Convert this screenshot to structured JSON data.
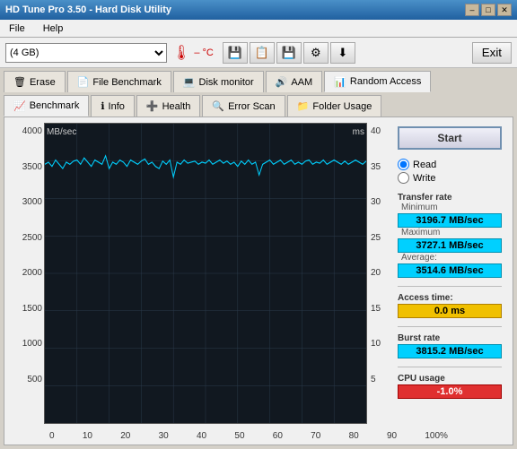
{
  "titleBar": {
    "title": "HD Tune Pro 3.50 - Hard Disk Utility",
    "minButton": "–",
    "maxButton": "□",
    "closeButton": "✕"
  },
  "menu": {
    "items": [
      "File",
      "Help"
    ]
  },
  "toolbar": {
    "driveLabel": "(4 GB)",
    "temp": "– °C",
    "exitLabel": "Exit"
  },
  "tabs1": [
    {
      "label": "Erase",
      "icon": "🗑"
    },
    {
      "label": "File Benchmark",
      "icon": "📄"
    },
    {
      "label": "Disk monitor",
      "icon": "💻"
    },
    {
      "label": "AAM",
      "icon": "🔊"
    },
    {
      "label": "Random Access",
      "icon": "📊",
      "active": true
    }
  ],
  "tabs2": [
    {
      "label": "Benchmark",
      "icon": "📈",
      "active": true
    },
    {
      "label": "Info",
      "icon": "ℹ"
    },
    {
      "label": "Health",
      "icon": "➕"
    },
    {
      "label": "Error Scan",
      "icon": "🔍"
    },
    {
      "label": "Folder Usage",
      "icon": "📁"
    }
  ],
  "chart": {
    "yAxisLeft": {
      "label": "MB/sec",
      "values": [
        "4000",
        "3500",
        "3000",
        "2500",
        "2000",
        "1500",
        "1000",
        "500",
        ""
      ]
    },
    "yAxisRight": {
      "label": "ms",
      "values": [
        "40",
        "35",
        "30",
        "25",
        "20",
        "15",
        "10",
        "5",
        ""
      ]
    },
    "xAxis": [
      "0",
      "10",
      "20",
      "30",
      "40",
      "50",
      "60",
      "70",
      "80",
      "90",
      "100%"
    ]
  },
  "infoPanel": {
    "startButton": "Start",
    "radioRead": "Read",
    "radioWrite": "Write",
    "readChecked": true,
    "transferRate": "Transfer rate",
    "minimumLabel": "Minimum",
    "minimumValue": "3196.7 MB/sec",
    "maximumLabel": "Maximum",
    "maximumValue": "3727.1 MB/sec",
    "averageLabel": "Average:",
    "averageValue": "3514.6 MB/sec",
    "accessTimeLabel": "Access time:",
    "accessTimeValue": "0.0 ms",
    "burstRateLabel": "Burst rate",
    "burstRateValue": "3815.2 MB/sec",
    "cpuUsageLabel": "CPU usage",
    "cpuUsageValue": "-1.0%"
  }
}
